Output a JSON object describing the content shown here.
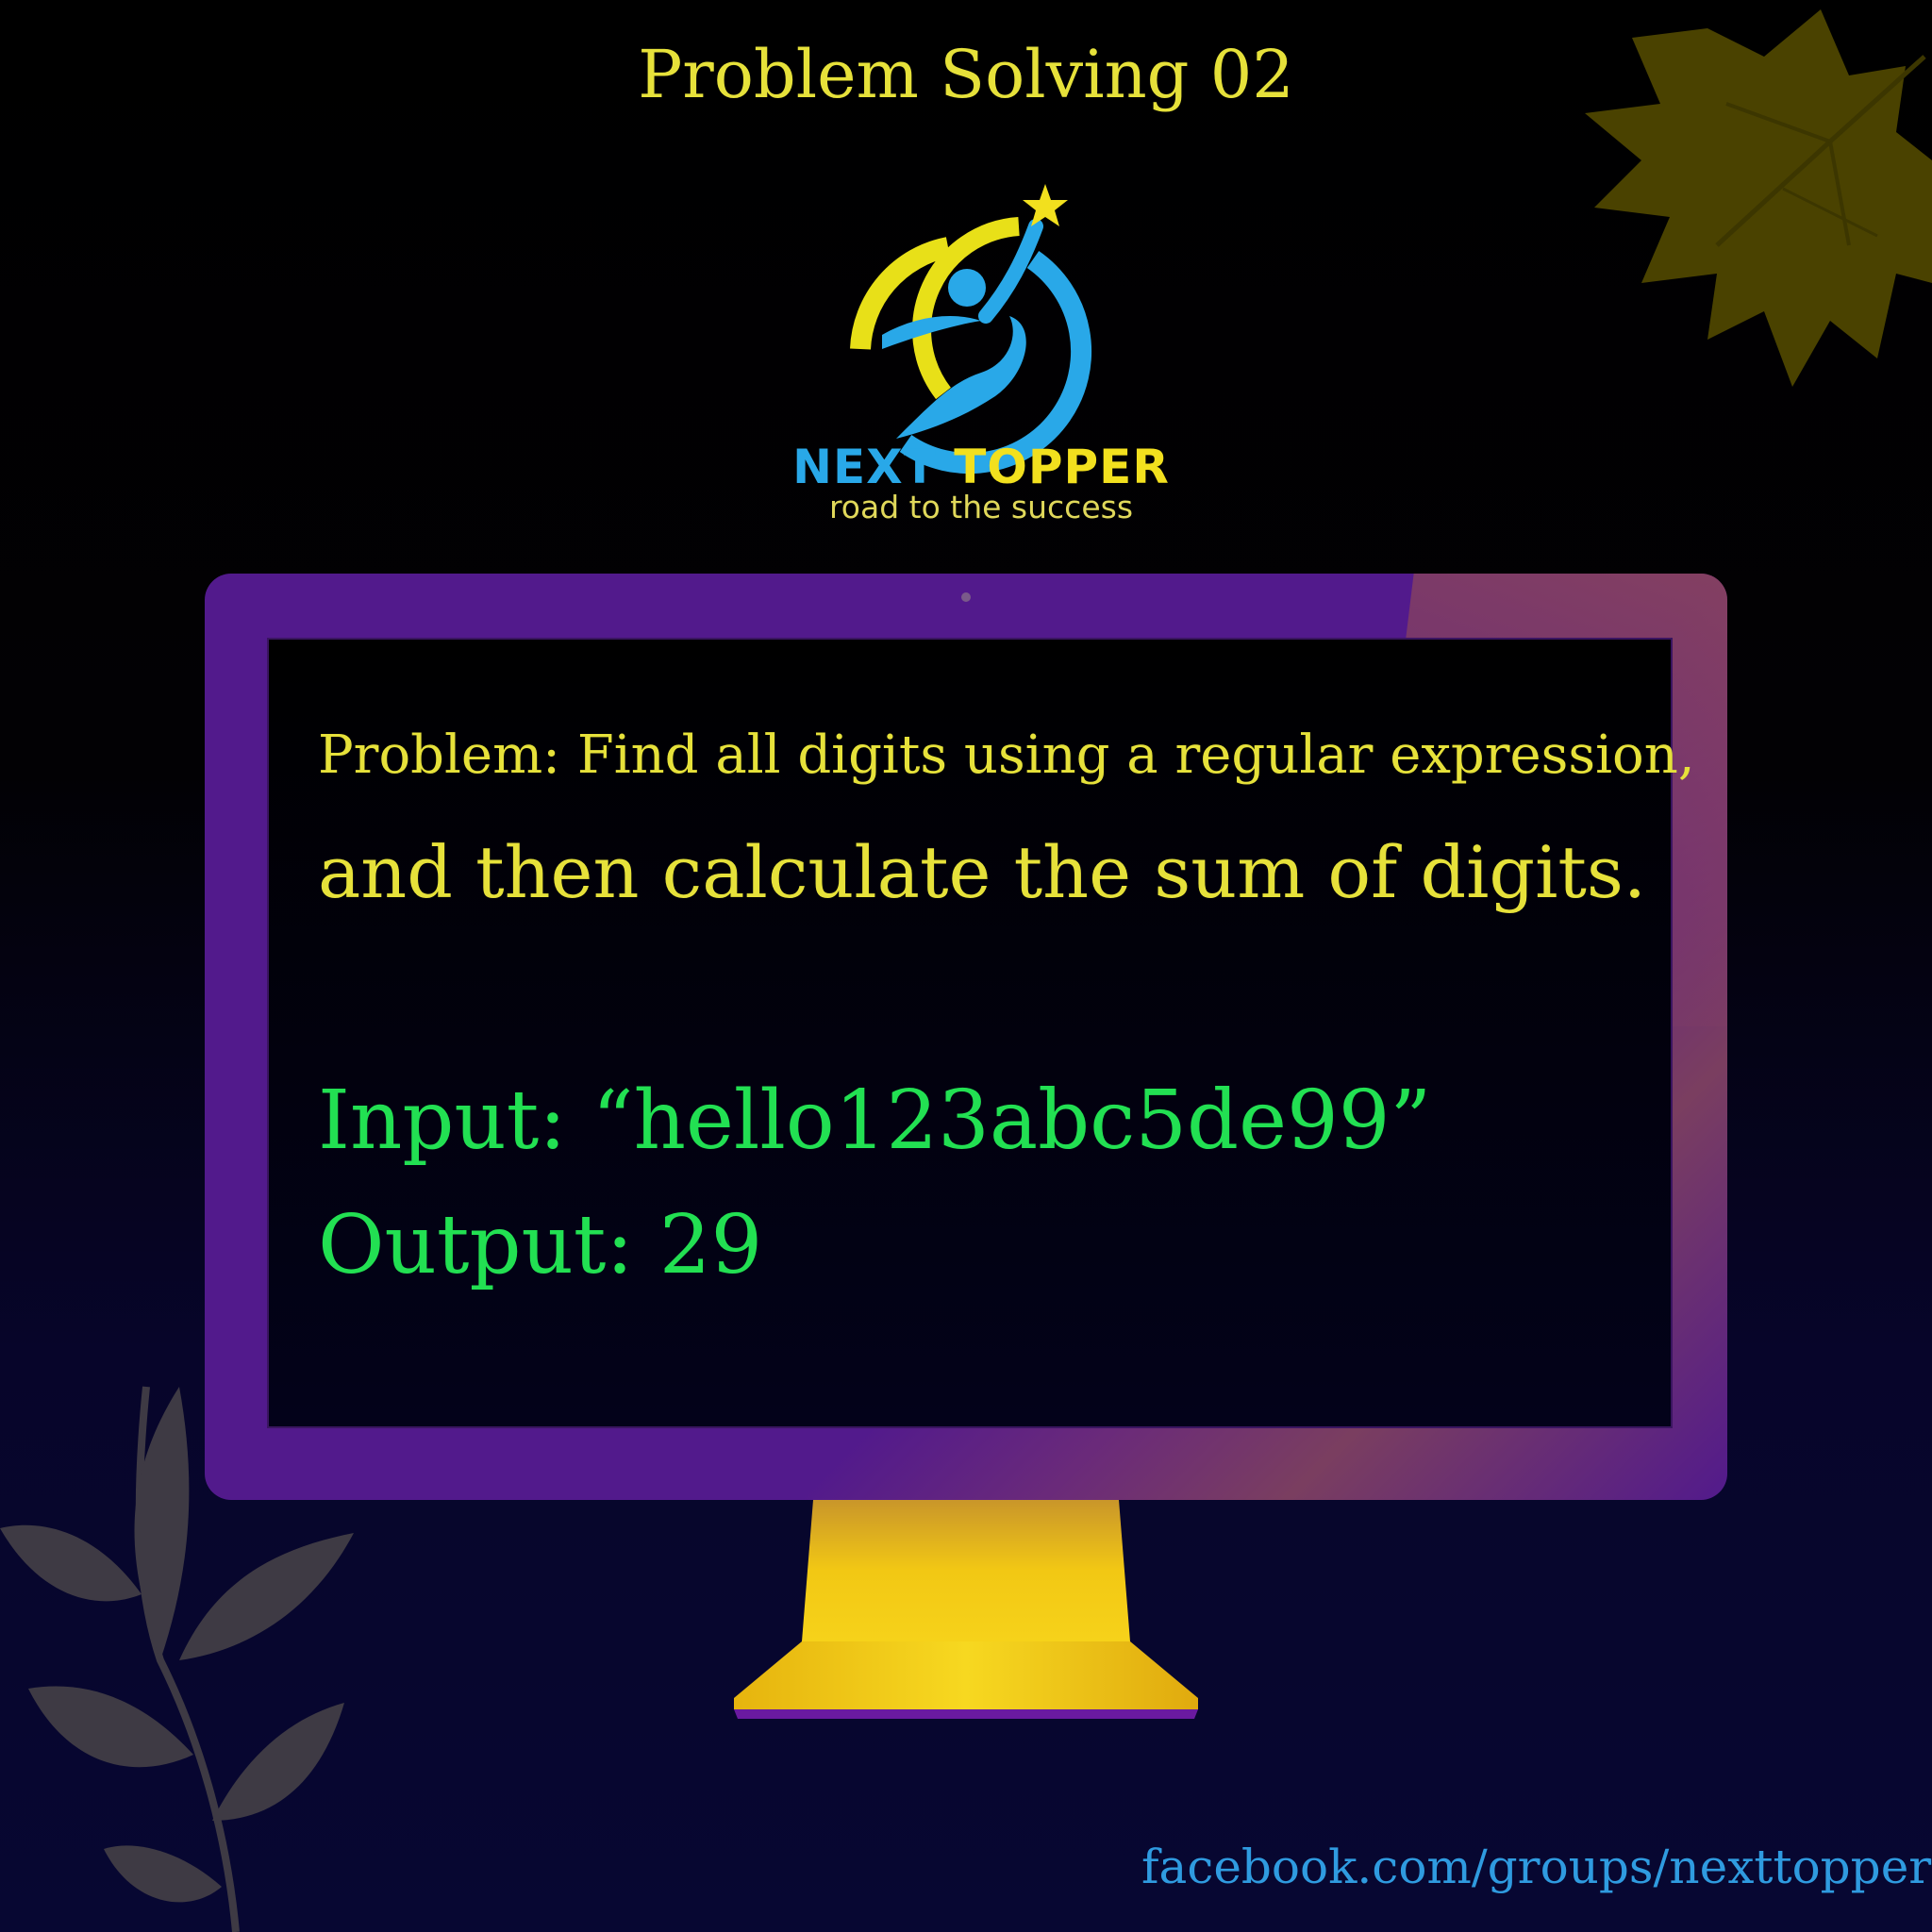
{
  "header": {
    "title": "Problem Solving 02"
  },
  "logo": {
    "brand_word1": "NEXT",
    "brand_word2": "TOPPER",
    "tagline": "road to the success",
    "colors": {
      "blue": "#29a8e8",
      "yellow": "#f2e01e"
    }
  },
  "monitor": {
    "problem_line1": "Problem: Find all digits using a regular expression,",
    "problem_line2": "and then calculate the sum of digits.",
    "input_line": "Input: “hello123abc5de99”",
    "output_line": "Output: 29",
    "frame_color": "#521a8c",
    "stand_color": "#f2c814"
  },
  "footer": {
    "link_text": "facebook.com/groups/nexttopper"
  },
  "decorations": {
    "top_right": "maple-leaf-icon",
    "bottom_left": "plant-branch-icon"
  },
  "colors": {
    "title_yellow": "#e6e13a",
    "code_green": "#22e052",
    "link_blue": "#2f9be0"
  }
}
